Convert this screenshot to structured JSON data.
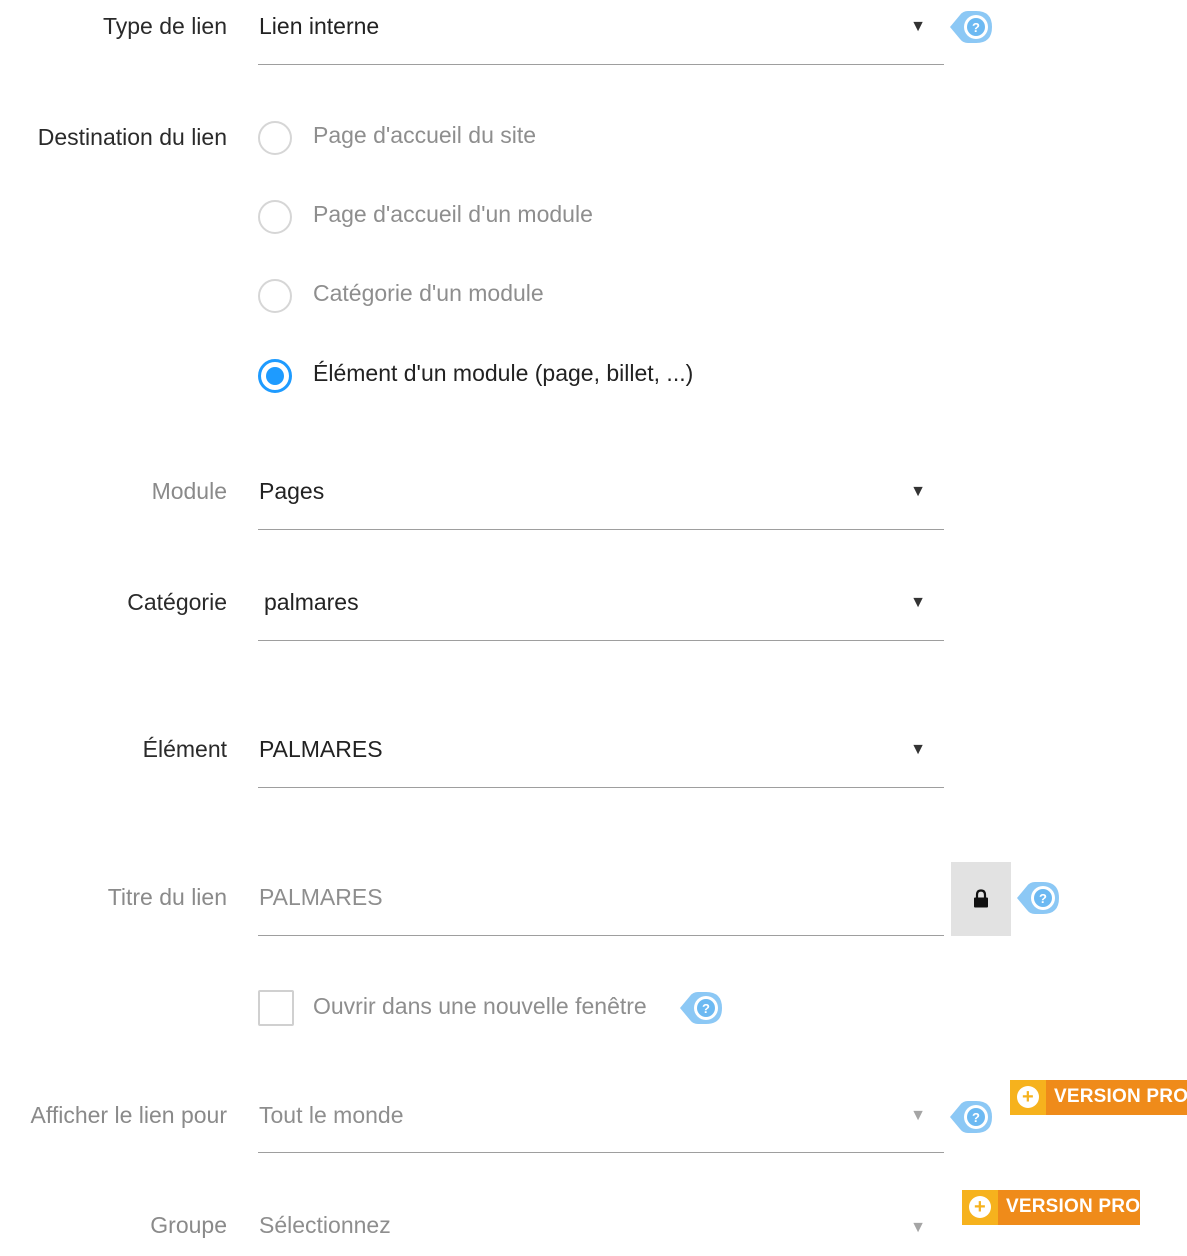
{
  "type_lien": {
    "label": "Type de lien",
    "value": "Lien interne"
  },
  "destination": {
    "label": "Destination du lien",
    "options": [
      {
        "label": "Page d'accueil du site",
        "selected": false
      },
      {
        "label": "Page d'accueil d'un module",
        "selected": false
      },
      {
        "label": "Catégorie d'un module",
        "selected": false
      },
      {
        "label": "Élément d'un module (page, billet, ...)",
        "selected": true
      }
    ]
  },
  "module": {
    "label": "Module",
    "value": "Pages"
  },
  "categorie": {
    "label": "Catégorie",
    "value": "palmares"
  },
  "element": {
    "label": "Élément",
    "value": "PALMARES"
  },
  "titre": {
    "label": "Titre du lien",
    "value": "PALMARES"
  },
  "nouvelle_fenetre": {
    "label": "Ouvrir dans une nouvelle fenêtre",
    "checked": false
  },
  "afficher": {
    "label": "Afficher le lien pour",
    "value": "Tout le monde",
    "badge": "VERSION PRO"
  },
  "groupe": {
    "label": "Groupe",
    "value": "Sélectionnez",
    "badge": "VERSION PRO"
  },
  "icons": {
    "help": "question-help-icon",
    "lock": "lock-icon",
    "plus": "plus-circle-icon",
    "caret": "dropdown-caret-icon"
  },
  "colors": {
    "accent": "#1e9bff",
    "help": "#6cb9f2",
    "pro_badge": "#ef8b1a",
    "pro_plus": "#f6b21d"
  }
}
